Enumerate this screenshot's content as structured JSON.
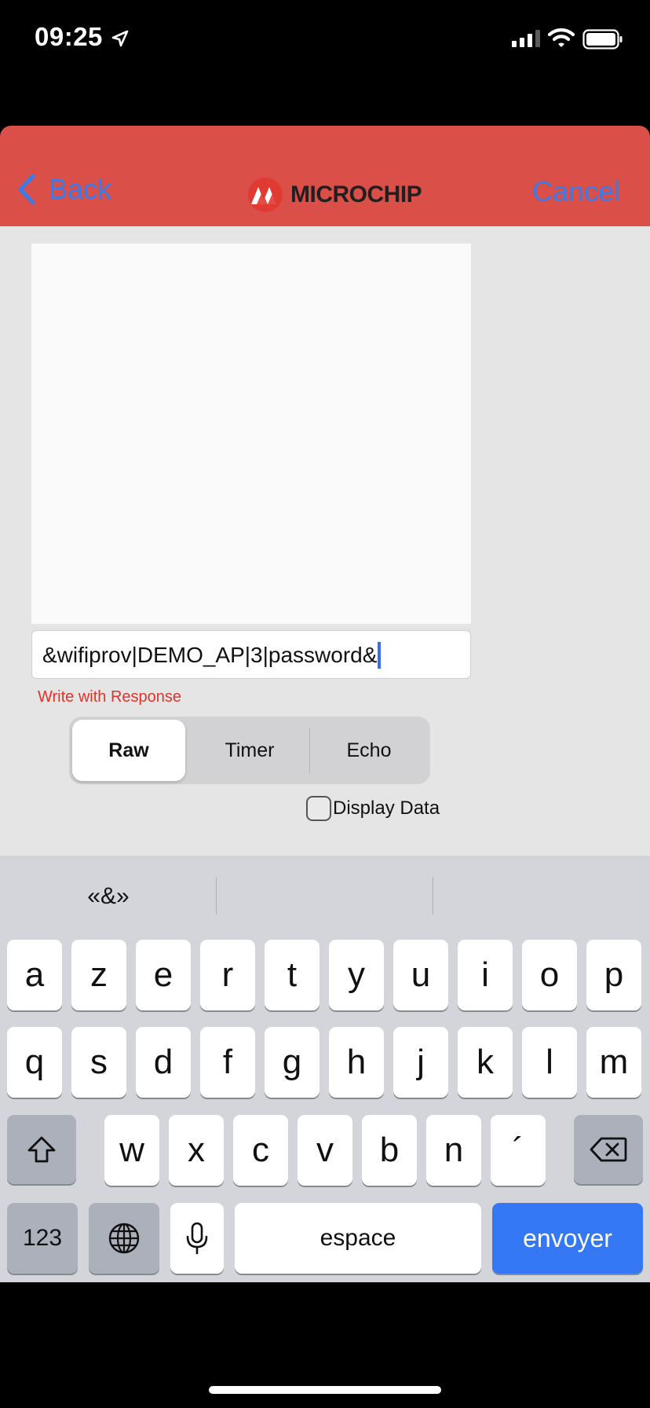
{
  "status_bar": {
    "time": "09:25"
  },
  "nav": {
    "back_label": "Back",
    "logo_text": "MICROCHIP",
    "cancel_label": "Cancel"
  },
  "terminal": {
    "command_value": "&wifiprov|DEMO_AP|3|password&",
    "write_mode": "Write with Response",
    "segments": [
      {
        "label": "Raw",
        "selected": true
      },
      {
        "label": "Timer",
        "selected": false
      },
      {
        "label": "Echo",
        "selected": false
      }
    ],
    "display_data_label": "Display Data",
    "display_data_checked": false
  },
  "keyboard": {
    "suggestions": [
      "«&»",
      "",
      ""
    ],
    "row1": [
      "a",
      "z",
      "e",
      "r",
      "t",
      "y",
      "u",
      "i",
      "o",
      "p"
    ],
    "row2": [
      "q",
      "s",
      "d",
      "f",
      "g",
      "h",
      "j",
      "k",
      "l",
      "m"
    ],
    "row3": [
      "w",
      "x",
      "c",
      "v",
      "b",
      "n",
      "´"
    ],
    "numbers_label": "123",
    "space_label": "espace",
    "send_label": "envoyer"
  },
  "colors": {
    "nav_bg": "#da5048",
    "link_blue": "#3b7ae8",
    "accent_red": "#e0342b",
    "send_key": "#3478f6"
  }
}
